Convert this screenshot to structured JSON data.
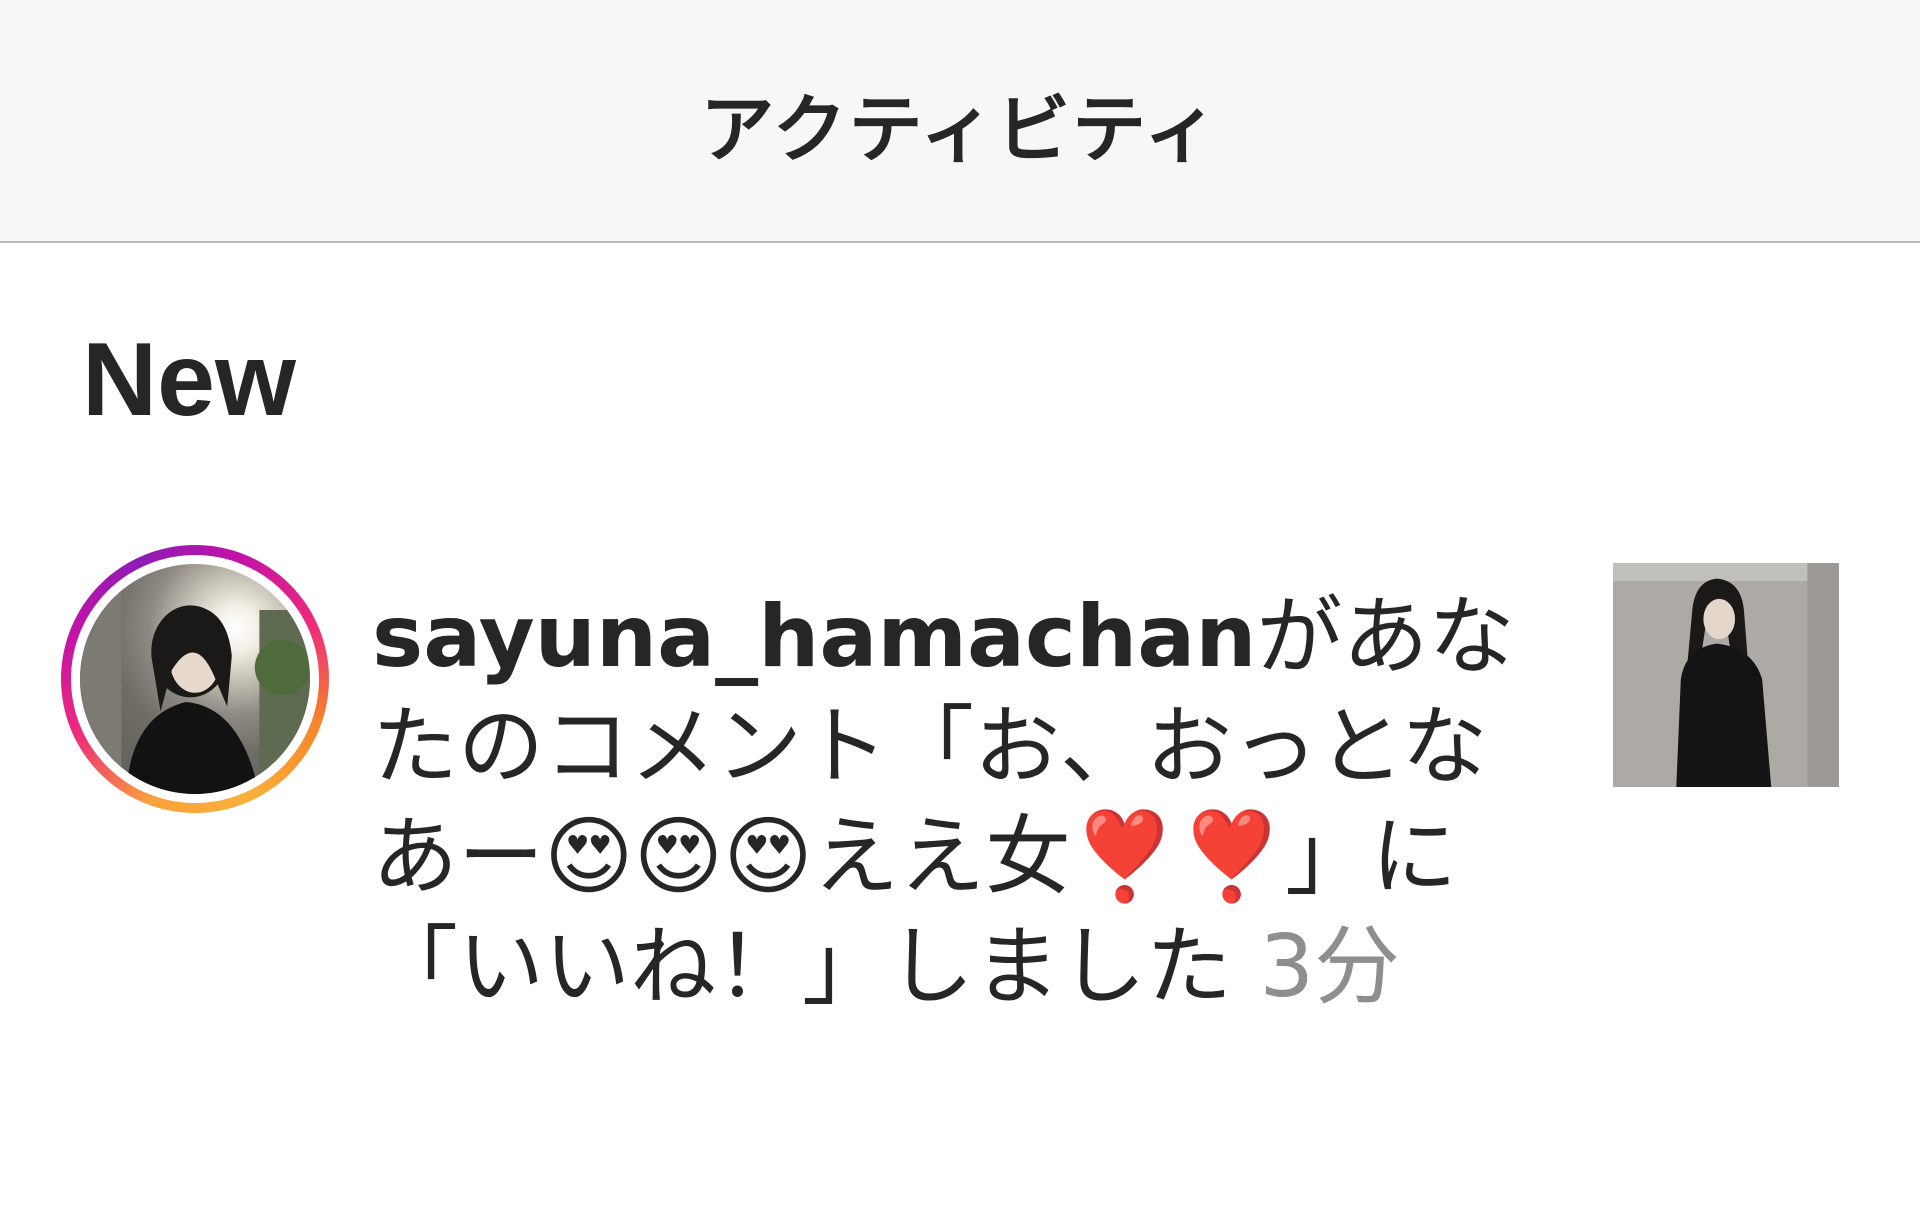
{
  "header": {
    "title": "アクティビティ"
  },
  "section": {
    "title": "New"
  },
  "notification": {
    "username": "sayuna_hamachan",
    "message": "があなたのコメント「お、おっとなあー😍😍😍ええ女❣️❣️」に「いいね！」しました",
    "time": "3分",
    "avatar_icon": "user-avatar-story-ring",
    "thumbnail_icon": "post-thumbnail"
  },
  "colors": {
    "header_bg": "#f7f7f7",
    "text": "#262626",
    "secondary_text": "#8e8e8e",
    "story_ring_start": "#f58529",
    "story_ring_end": "#c213a8"
  }
}
